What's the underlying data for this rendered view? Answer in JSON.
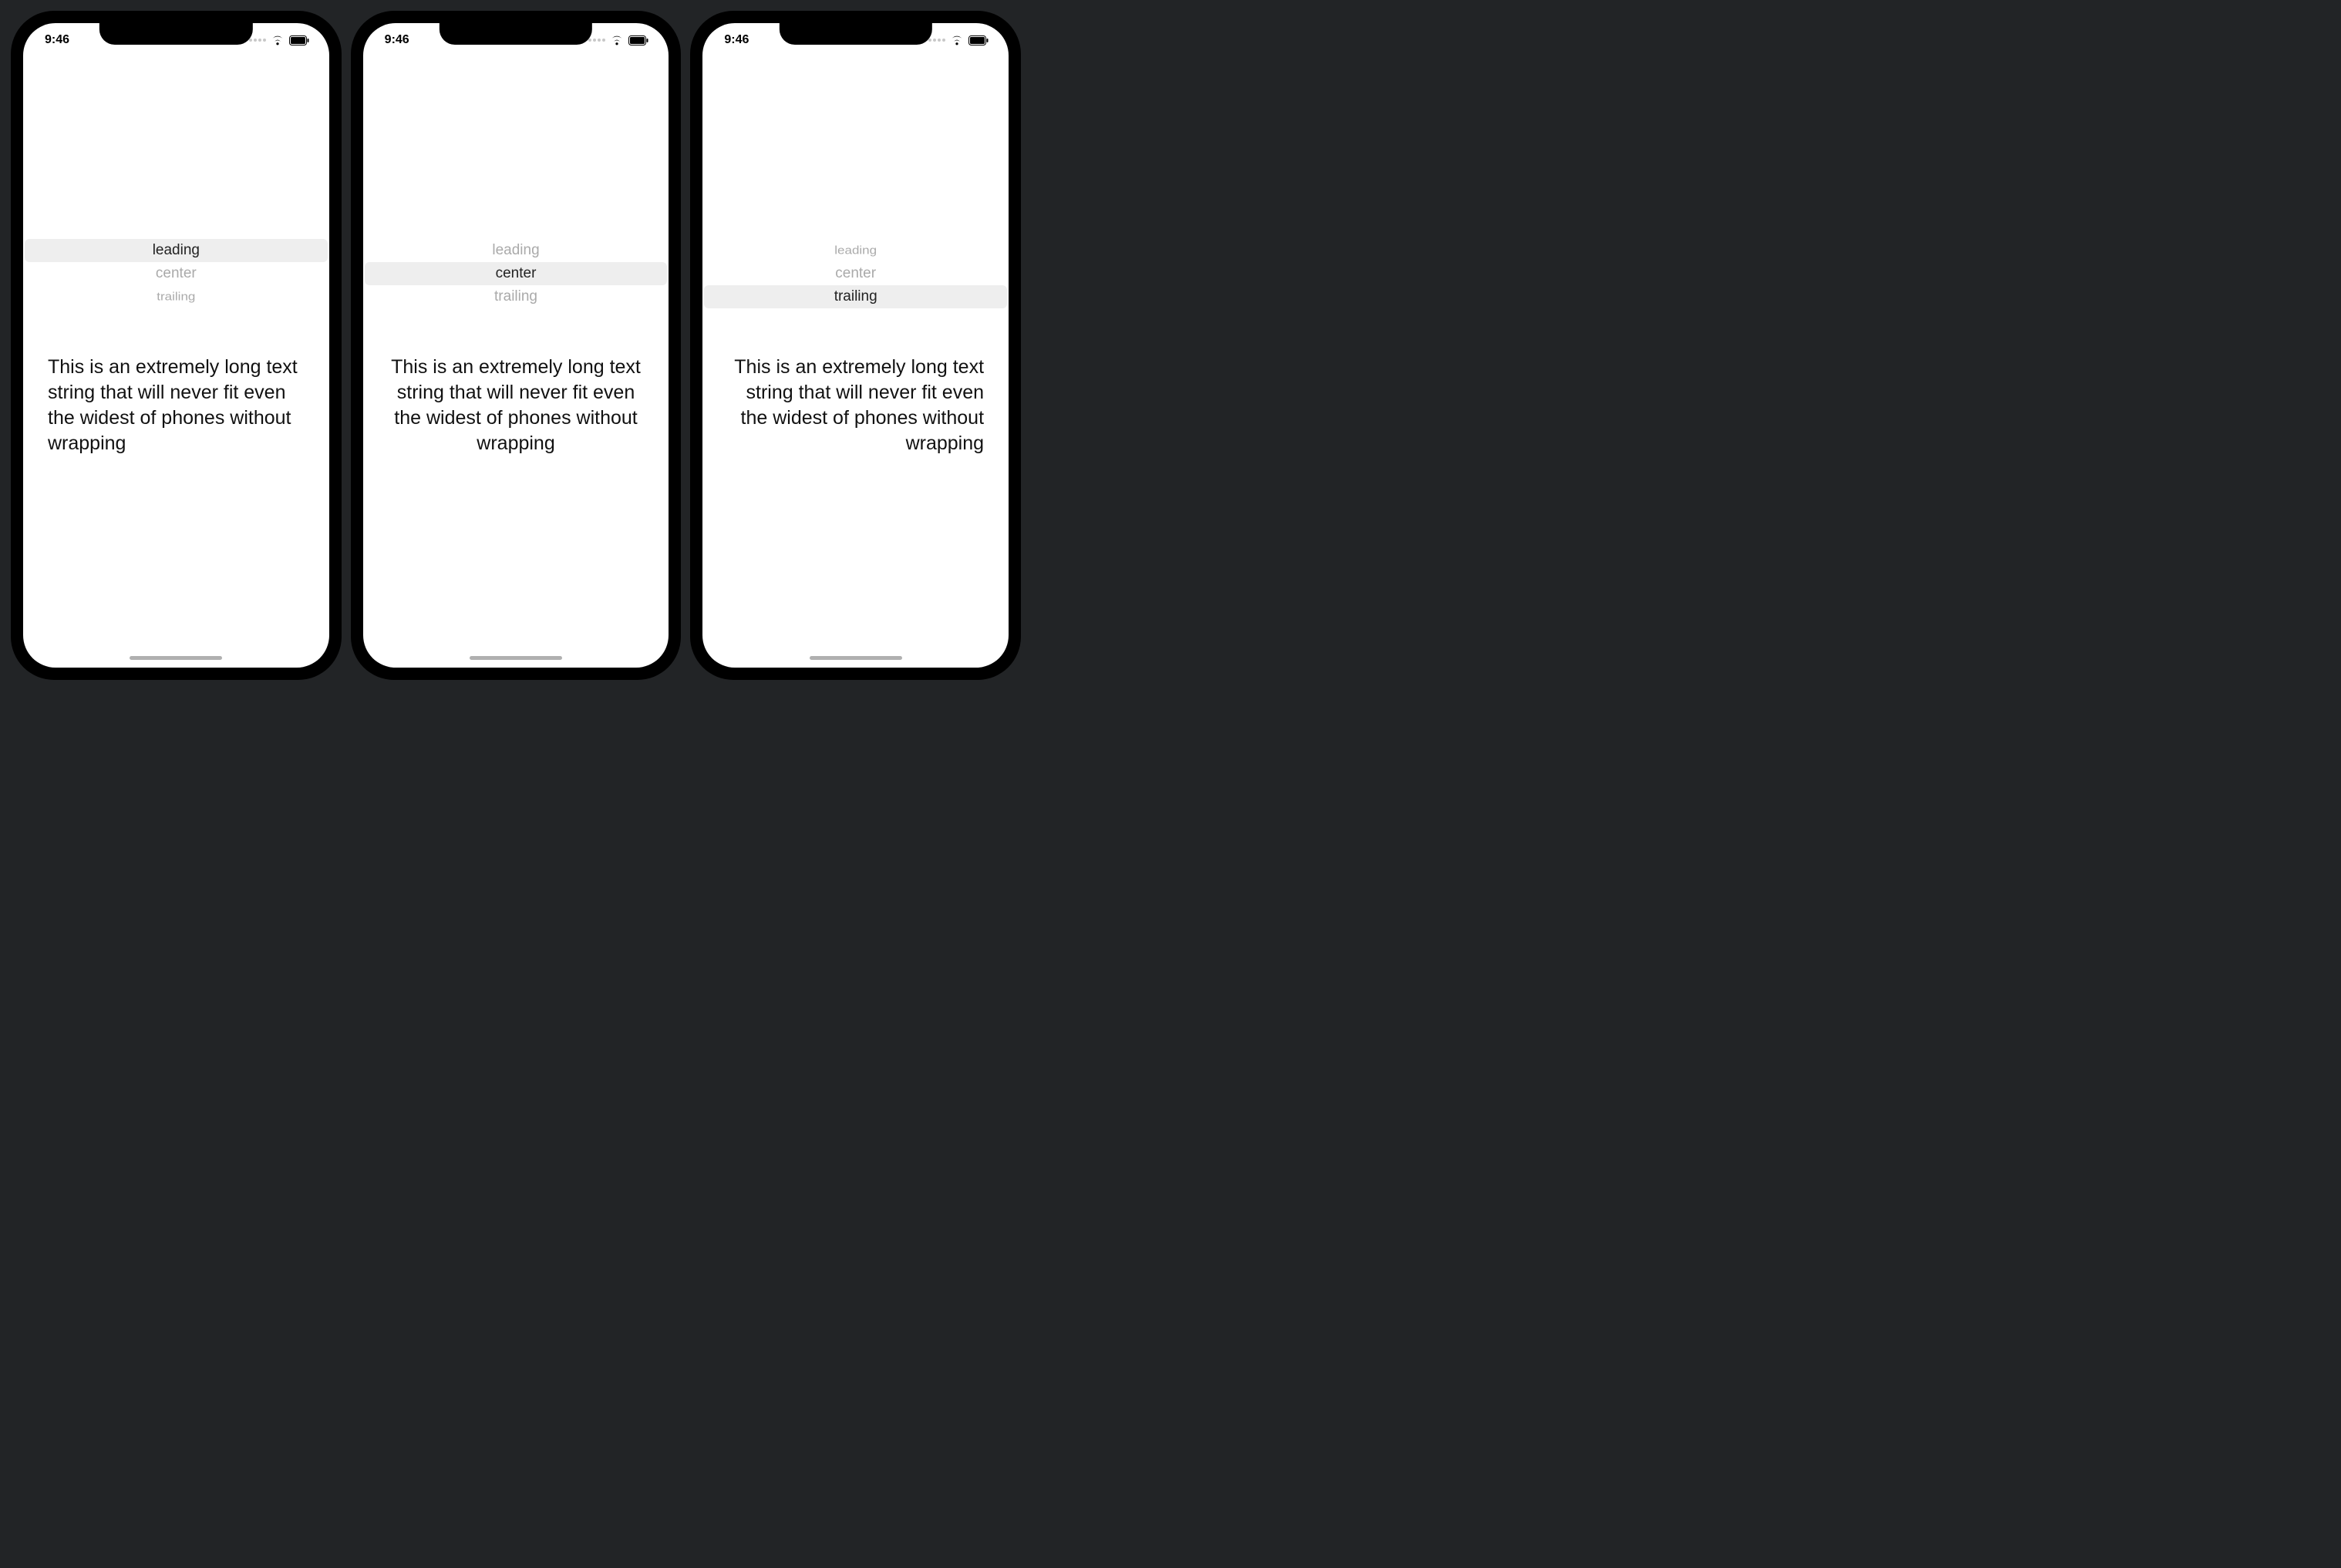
{
  "status": {
    "time": "9:46"
  },
  "picker_options": {
    "opt0": "leading",
    "opt1": "center",
    "opt2": "trailing"
  },
  "body_text": "This is an extremely long text string that will never fit even the widest of phones without wrapping",
  "phones": {
    "p1_selected": "leading",
    "p2_selected": "center",
    "p3_selected": "trailing"
  }
}
